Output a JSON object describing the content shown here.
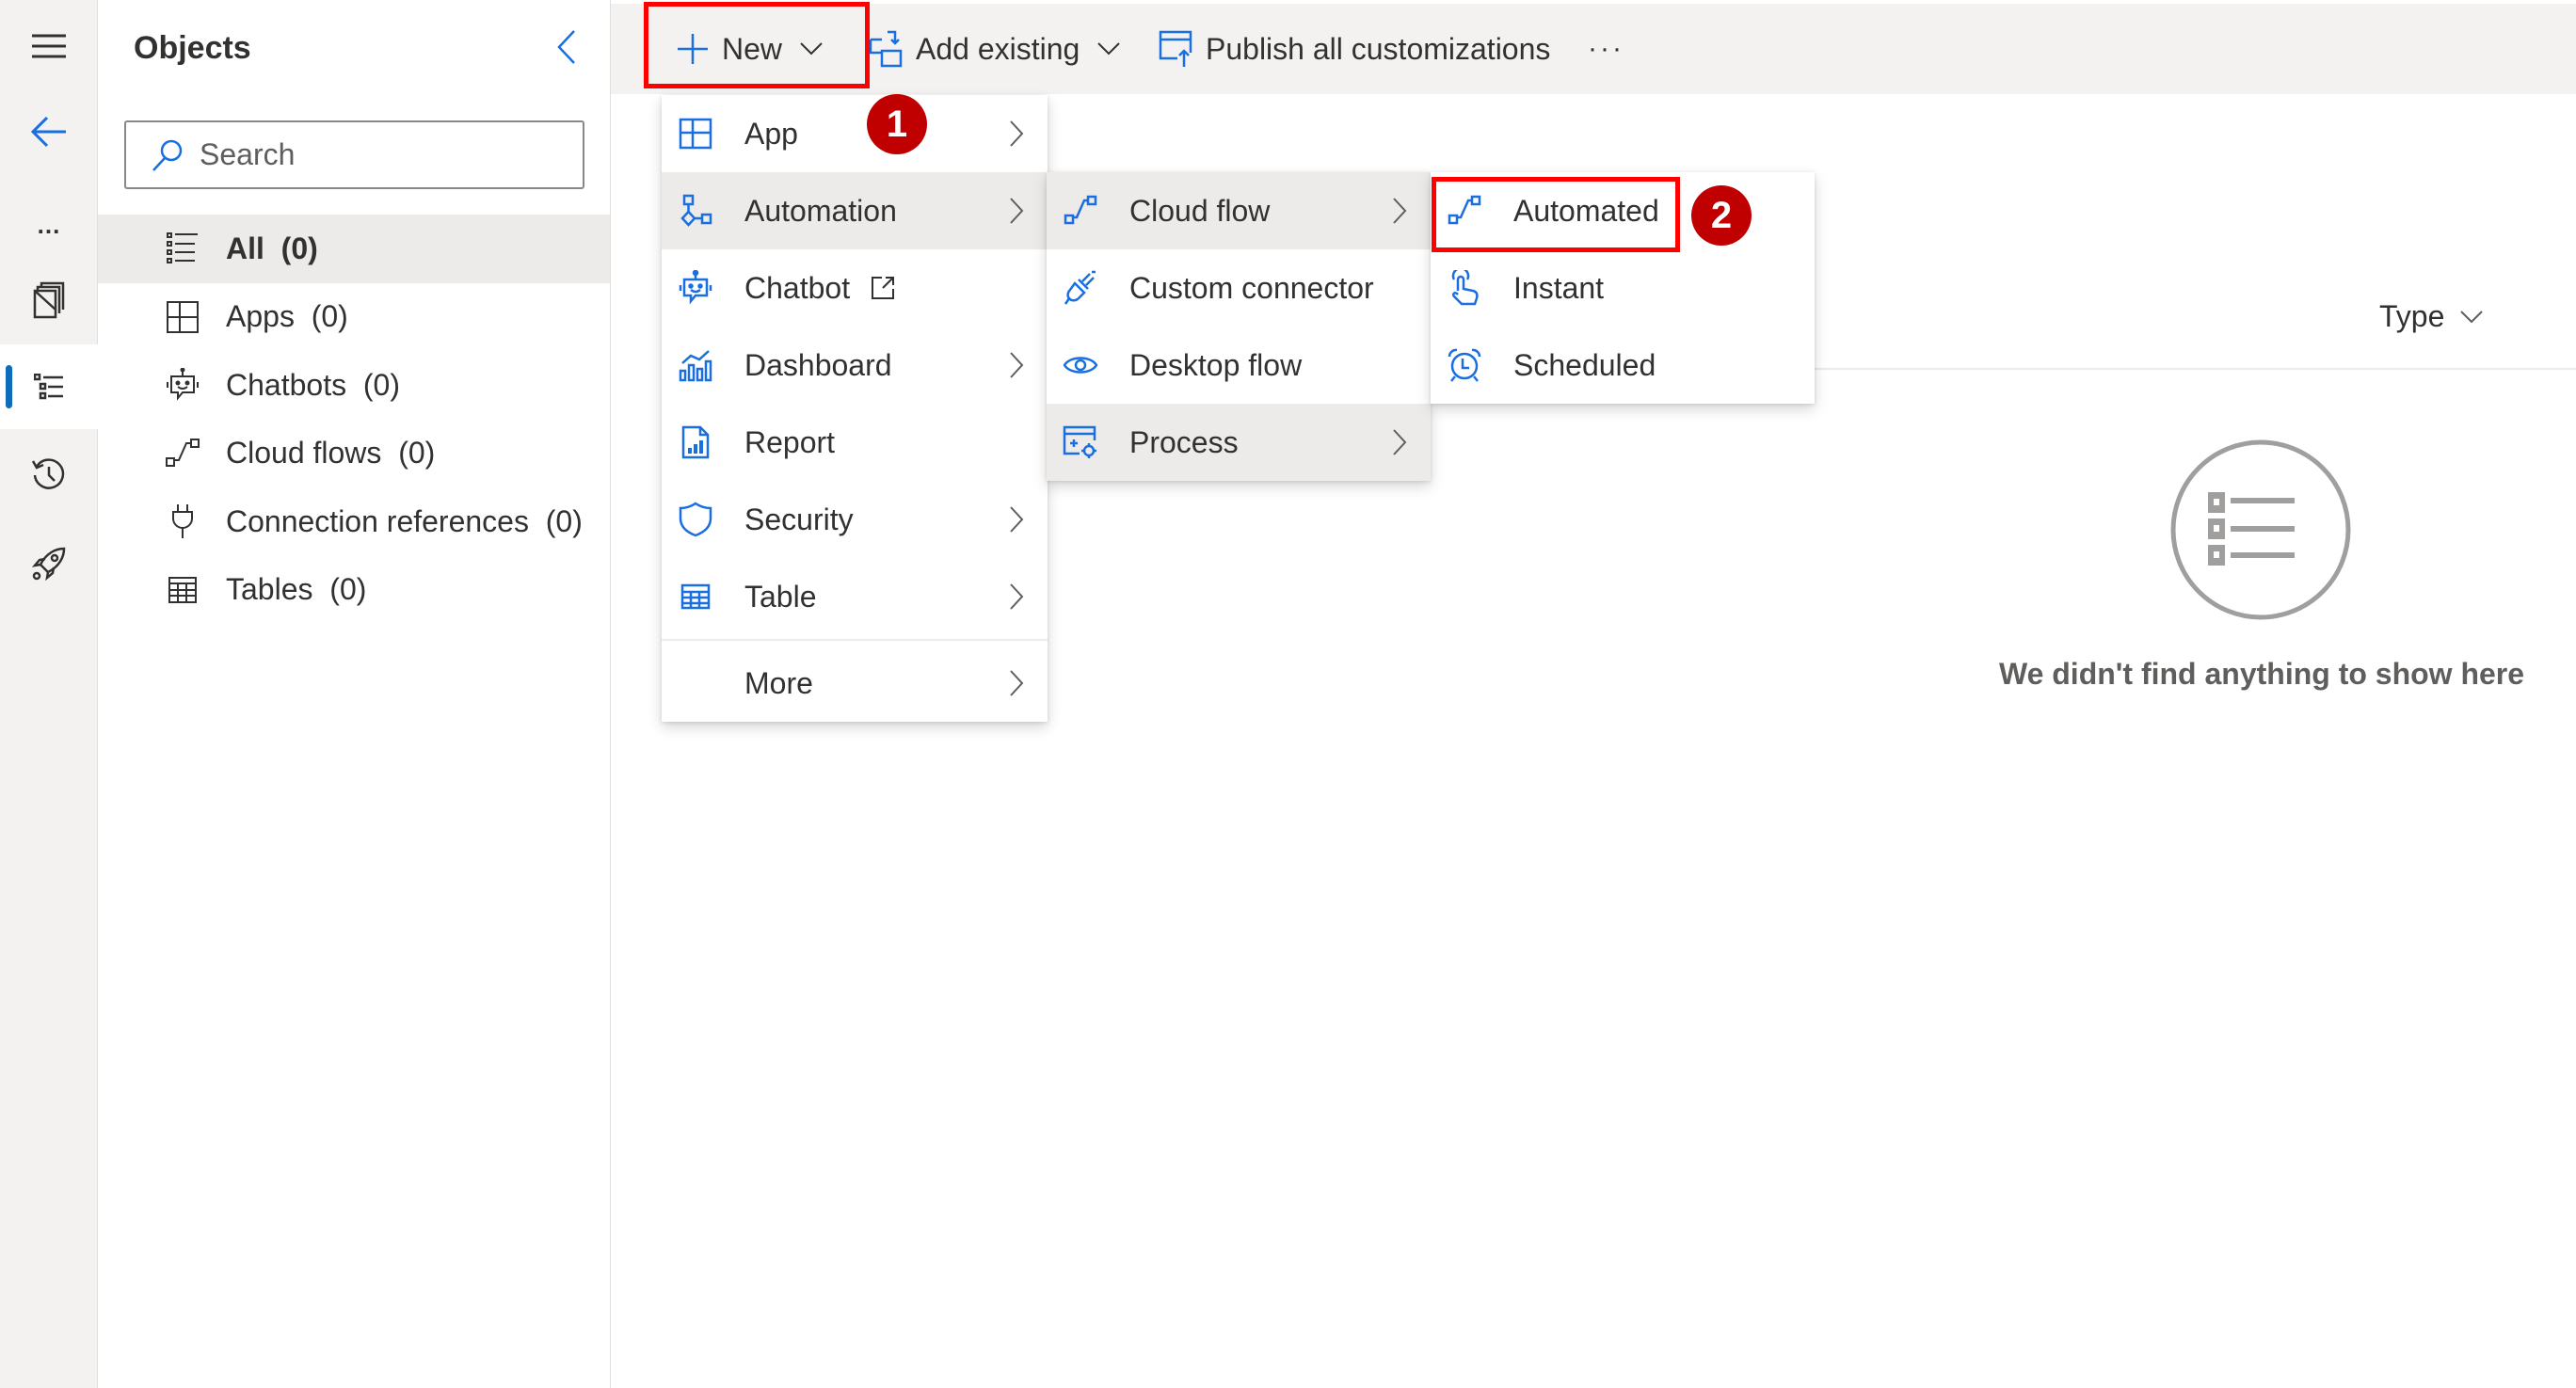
{
  "rail": {
    "items": [
      {
        "name": "menu",
        "icon": "hamburger-icon"
      },
      {
        "name": "back",
        "icon": "back-arrow-icon"
      },
      {
        "name": "more",
        "icon": "ellipsis-icon",
        "label": "..."
      },
      {
        "name": "overview",
        "icon": "pages-icon"
      },
      {
        "name": "objects",
        "icon": "list-icon",
        "active": true
      },
      {
        "name": "history",
        "icon": "history-icon"
      },
      {
        "name": "pipelines",
        "icon": "rocket-icon"
      }
    ]
  },
  "objects_panel": {
    "title": "Objects",
    "search_placeholder": "Search",
    "items": [
      {
        "label": "All",
        "count": "(0)",
        "icon": "list-icon",
        "selected": true
      },
      {
        "label": "Apps",
        "count": "(0)",
        "icon": "app-grid-icon"
      },
      {
        "label": "Chatbots",
        "count": "(0)",
        "icon": "bot-icon"
      },
      {
        "label": "Cloud flows",
        "count": "(0)",
        "icon": "flow-icon"
      },
      {
        "label": "Connection references",
        "count": "(0)",
        "icon": "plug-icon"
      },
      {
        "label": "Tables",
        "count": "(0)",
        "icon": "table-icon"
      }
    ]
  },
  "toolbar": {
    "new_label": "New",
    "add_existing_label": "Add existing",
    "publish_label": "Publish all customizations",
    "more_label": "···"
  },
  "new_menu": {
    "items": [
      {
        "label": "App",
        "icon": "app-grid-icon",
        "submenu": true
      },
      {
        "label": "Automation",
        "icon": "automation-icon",
        "submenu": true,
        "highlighted": true
      },
      {
        "label": "Chatbot",
        "icon": "bot-icon",
        "external": true
      },
      {
        "label": "Dashboard",
        "icon": "dashboard-icon",
        "submenu": true
      },
      {
        "label": "Report",
        "icon": "report-icon"
      },
      {
        "label": "Security",
        "icon": "shield-icon",
        "submenu": true
      },
      {
        "label": "Table",
        "icon": "table-icon",
        "submenu": true
      },
      {
        "label": "More",
        "submenu": true
      }
    ]
  },
  "automation_menu": {
    "items": [
      {
        "label": "Cloud flow",
        "icon": "flow-icon",
        "submenu": true,
        "highlighted": true
      },
      {
        "label": "Custom connector",
        "icon": "connector-icon"
      },
      {
        "label": "Desktop flow",
        "icon": "eye-icon"
      },
      {
        "label": "Process",
        "icon": "process-icon",
        "submenu": true,
        "highlighted": true
      }
    ]
  },
  "cloud_flow_menu": {
    "items": [
      {
        "label": "Automated",
        "icon": "flow-icon"
      },
      {
        "label": "Instant",
        "icon": "touch-icon"
      },
      {
        "label": "Scheduled",
        "icon": "alarm-clock-icon"
      }
    ]
  },
  "annotations": {
    "step1": "1",
    "step2": "2",
    "highlight_color": "#ff0000",
    "badge_color": "#c00000"
  },
  "main": {
    "column_header": "Type",
    "empty_message": "We didn't find anything to show here"
  },
  "colors": {
    "accent": "#0f6cbd",
    "icon_blue": "#1a6fe0",
    "toolbar_bg": "#f3f2f1",
    "selected_bg": "#edebe9"
  }
}
